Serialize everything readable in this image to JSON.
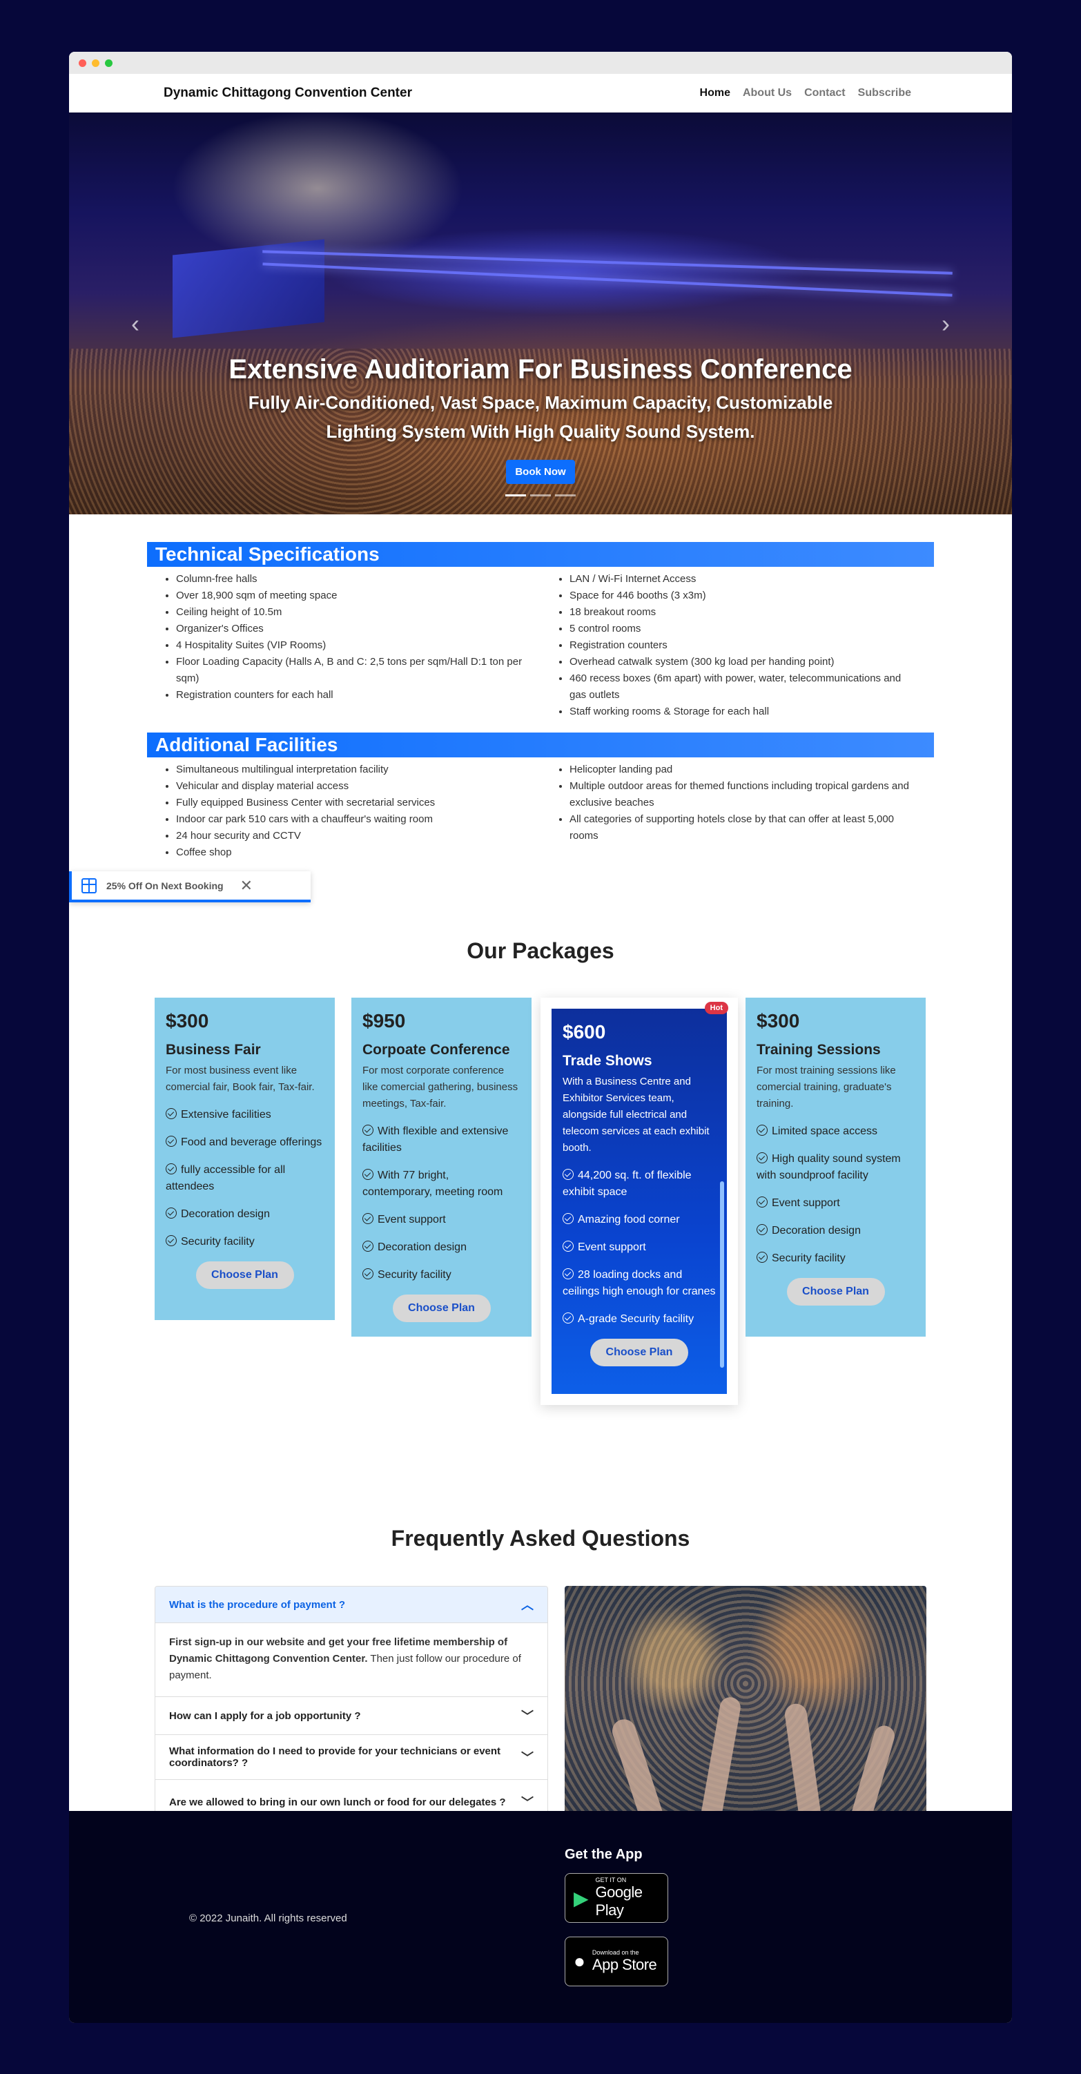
{
  "window": {
    "dots": [
      "#ff5f57",
      "#febc2e",
      "#28c840"
    ]
  },
  "navbar": {
    "brand": "Dynamic Chittagong Convention Center",
    "links": [
      "Home",
      "About Us",
      "Contact",
      "Subscribe"
    ]
  },
  "hero": {
    "title": "Extensive Auditoriam For Business Conference",
    "subtitle": "Fully Air-Conditioned, Vast Space, Maximum Capacity, Customizable Lighting System With High Quality Sound System.",
    "button": "Book Now",
    "prev": "‹",
    "next": "›",
    "active_slide": 1,
    "slide_count": 3
  },
  "technical": {
    "title": "Technical Specifications",
    "left": [
      "Column-free halls",
      "Over 18,900 sqm of meeting space",
      "Ceiling height of 10.5m",
      "Organizer's Offices",
      "4 Hospitality Suites (VIP Rooms)",
      "Floor Loading Capacity (Halls A, B and C: 2,5 tons per sqm/Hall D:1 ton per sqm)",
      "Registration counters for each hall"
    ],
    "right": [
      "LAN / Wi-Fi Internet Access",
      "Space for 446 booths (3 x3m)",
      "18 breakout rooms",
      "5 control rooms",
      "Registration counters",
      "Overhead catwalk system (300 kg load per handing point)",
      "460 recess boxes (6m apart) with power, water, telecommunications and gas outlets",
      "Staff working rooms & Storage for each hall"
    ]
  },
  "additional": {
    "title": "Additional Facilities",
    "left": [
      "Simultaneous multilingual interpretation facility",
      "Vehicular and display material access",
      "Fully equipped Business Center with secretarial services",
      "Indoor car park 510 cars with a chauffeur's waiting room",
      "24 hour security and CCTV",
      "Coffee shop"
    ],
    "right": [
      "Helicopter landing pad",
      "Multiple outdoor areas for themed functions including tropical gardens and exclusive beaches",
      "All categories of supporting hotels close by that can offer at least 5,000 rooms"
    ]
  },
  "promo": {
    "text": "25% Off On Next Booking",
    "close": "✕"
  },
  "packages": {
    "title": "Our Packages",
    "choose_label": "Choose Plan",
    "hot_label": "Hot",
    "plans": [
      {
        "price": "$300",
        "name": "Business Fair",
        "desc": "For most business event like comercial fair, Book fair, Tax-fair.",
        "features": [
          "Extensive facilities",
          "Food and beverage offerings",
          "fully accessible for all attendees",
          "Decoration design",
          "Security facility"
        ]
      },
      {
        "price": "$950",
        "name": "Corpoate Conference",
        "desc": "For most corporate conference like comercial gathering, business meetings, Tax-fair.",
        "features": [
          "With flexible and extensive facilities",
          "With 77 bright, contemporary, meeting room",
          "Event support",
          "Decoration design",
          "Security facility"
        ]
      },
      {
        "price": "$600",
        "name": "Trade Shows",
        "desc": "With a Business Centre and Exhibitor Services team, alongside full electrical and telecom services at each exhibit booth.",
        "features": [
          "44,200 sq. ft. of flexible exhibit space",
          "Amazing food corner",
          "Event support",
          "28 loading docks and ceilings high enough for cranes",
          "A-grade Security facility"
        ]
      },
      {
        "price": "$300",
        "name": "Training Sessions",
        "desc": "For most training sessions like comercial training, graduate's training.",
        "features": [
          "Limited space access",
          "High quality sound system with soundproof facility",
          "Event support",
          "Decoration design",
          "Security facility"
        ]
      }
    ]
  },
  "faq": {
    "title": "Frequently Asked Questions",
    "items": [
      {
        "q": "What is the procedure of payment ?",
        "a_bold": "First sign-up in our website and get your free lifetime membership of Dynamic Chittagong Convention Center.",
        "a_rest": " Then just follow our procedure of payment."
      },
      {
        "q": "How can I apply for a job opportunity ?"
      },
      {
        "q": "What information do I need to provide for your technicians or event coordinators? ?"
      },
      {
        "q": "Are we allowed to bring in our own lunch or food for our delegates ?"
      }
    ]
  },
  "footer": {
    "copyright": "© 2022 Junaith. All rights reserved",
    "app_title": "Get the App",
    "google": {
      "small": "GET IT ON",
      "big": "Google Play"
    },
    "apple": {
      "small": "Download on the",
      "big": "App Store"
    }
  }
}
